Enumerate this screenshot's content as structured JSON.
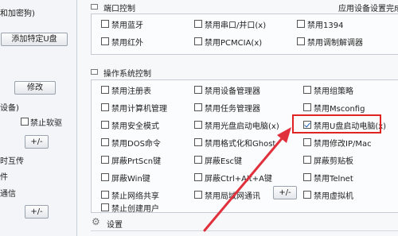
{
  "left": {
    "line1": "和加密狗)",
    "add_usb_button": "添加特定U盘",
    "modify_button": "修改",
    "device_suffix": "设备)",
    "disable_soft_drive": "禁止软驱",
    "plusminus_1": "+/-",
    "mutual_transfer": "时互传",
    "item_piece": "件",
    "communication": "通信",
    "plusminus_2": "+/-"
  },
  "port_section": {
    "title": "端口控制",
    "status_text": "应用设备设置完成",
    "items": [
      {
        "label": "禁用蓝牙",
        "checked": false
      },
      {
        "label": "禁用串口/并口(x)",
        "checked": false
      },
      {
        "label": "禁用1394",
        "checked": false
      },
      {
        "label": "禁用红外",
        "checked": false
      },
      {
        "label": "禁用PCMCIA(x)",
        "checked": false
      },
      {
        "label": "禁用调制解调器",
        "checked": false
      }
    ]
  },
  "os_section": {
    "title": "操作系统控制",
    "items": [
      {
        "label": "禁用注册表",
        "checked": false
      },
      {
        "label": "禁用设备管理器",
        "checked": false
      },
      {
        "label": "禁用组策略",
        "checked": false
      },
      {
        "label": "禁用计算机管理",
        "checked": false
      },
      {
        "label": "禁用任务管理器",
        "checked": false
      },
      {
        "label": "禁用Msconfig",
        "checked": false
      },
      {
        "label": "禁用安全模式",
        "checked": false
      },
      {
        "label": "禁用光盘启动电脑(x)",
        "checked": false
      },
      {
        "label": "禁用U盘启动电脑(x)",
        "checked": true
      },
      {
        "label": "禁用DOS命令",
        "checked": false
      },
      {
        "label": "禁用格式化和Ghost",
        "checked": false
      },
      {
        "label": "禁用修改IP/Mac",
        "checked": false
      },
      {
        "label": "屏蔽PrtScn键",
        "checked": false
      },
      {
        "label": "屏蔽Esc键",
        "checked": false
      },
      {
        "label": "屏蔽剪贴板",
        "checked": false
      },
      {
        "label": "屏蔽Win键",
        "checked": false
      },
      {
        "label": "屏蔽Ctrl+Alt+A键",
        "checked": false
      },
      {
        "label": "禁用Telnet",
        "checked": false
      },
      {
        "label": "禁止网络共享",
        "checked": false
      },
      {
        "label": "禁用局域网通讯",
        "checked": false
      },
      {
        "label": "禁用虚拟机",
        "checked": false
      },
      {
        "label": "禁止创建用户",
        "checked": false
      }
    ],
    "plusminus_button": "+/-"
  },
  "settings_section": {
    "title": "设置"
  },
  "colors": {
    "highlight": "#e02424",
    "arrow": "#e0303c",
    "check": "#1a5fb4"
  }
}
